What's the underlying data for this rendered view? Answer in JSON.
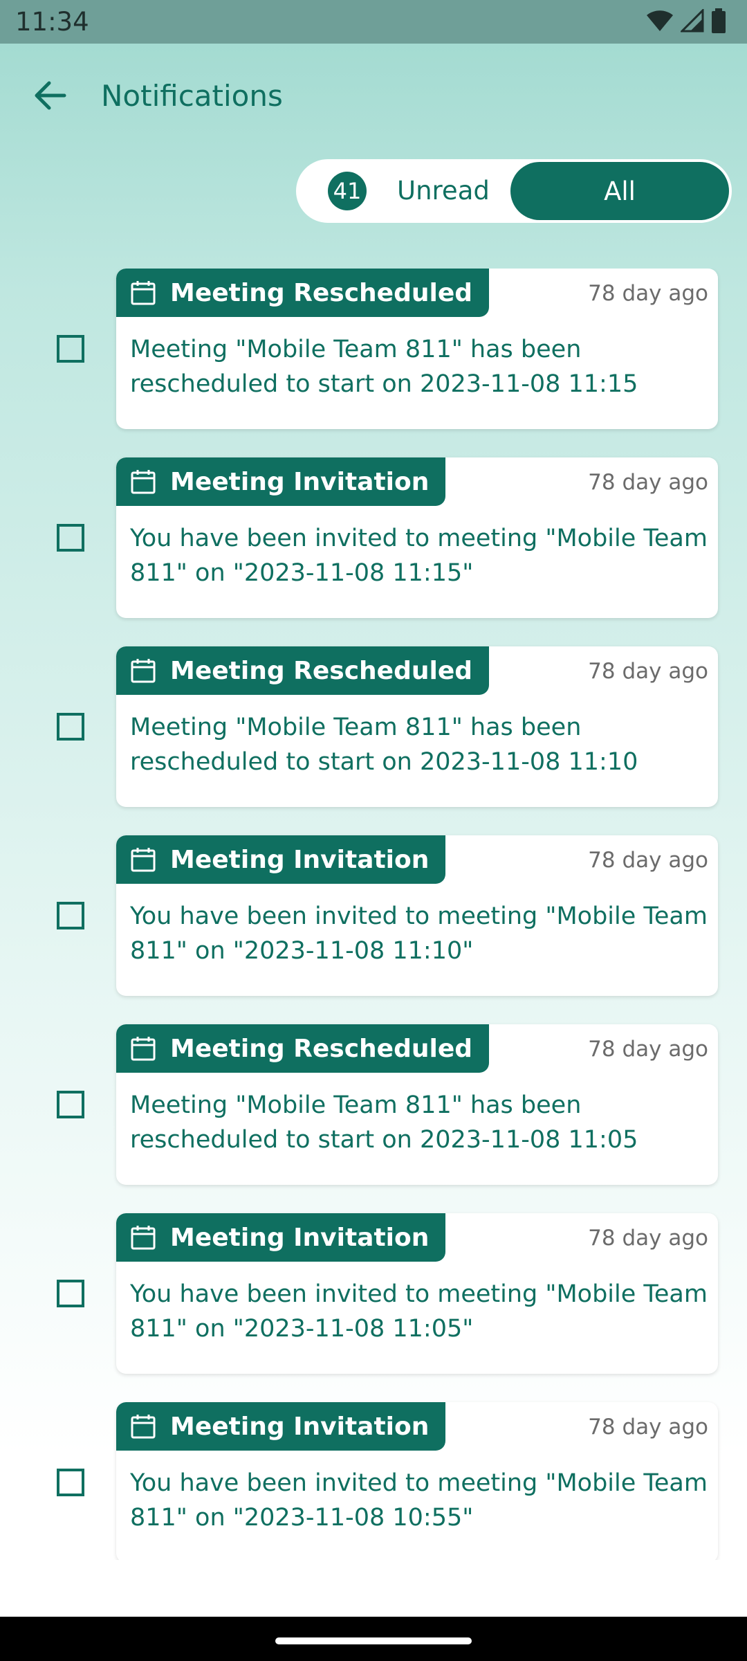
{
  "status_bar": {
    "time": "11:34",
    "icons": [
      "wifi-icon",
      "signal-icon",
      "battery-icon"
    ]
  },
  "header": {
    "title": "Notifications",
    "back_icon": "arrow-left-icon"
  },
  "filter": {
    "unread_count": "41",
    "unread_label": "Unread",
    "all_label": "All",
    "selected": "All"
  },
  "notifications": [
    {
      "type": "Meeting Rescheduled",
      "time_ago": "78 day ago",
      "message": "Meeting \"Mobile Team 811\" has been rescheduled to start on 2023-11-08 11:15",
      "checked": false
    },
    {
      "type": "Meeting Invitation",
      "time_ago": "78 day ago",
      "message": "You have been invited to meeting \"Mobile Team 811\" on \"2023-11-08 11:15\"",
      "checked": false
    },
    {
      "type": "Meeting Rescheduled",
      "time_ago": "78 day ago",
      "message": "Meeting \"Mobile Team 811\" has been rescheduled to start on 2023-11-08 11:10",
      "checked": false
    },
    {
      "type": "Meeting Invitation",
      "time_ago": "78 day ago",
      "message": "You have been invited to meeting \"Mobile Team 811\" on \"2023-11-08 11:10\"",
      "checked": false
    },
    {
      "type": "Meeting Rescheduled",
      "time_ago": "78 day ago",
      "message": "Meeting \"Mobile Team 811\" has been rescheduled to start on 2023-11-08 11:05",
      "checked": false
    },
    {
      "type": "Meeting Invitation",
      "time_ago": "78 day ago",
      "message": "You have been invited to meeting \"Mobile Team 811\" on \"2023-11-08 11:05\"",
      "checked": false
    },
    {
      "type": "Meeting Invitation",
      "time_ago": "78 day ago",
      "message": "You have been invited to meeting \"Mobile Team 811\" on \"2023-11-08 10:55\"",
      "checked": false
    }
  ],
  "colors": {
    "primary": "#0f6f60",
    "status_bar": "#6f9f98",
    "muted_text": "#6b6b6b",
    "card_background": "#ffffff"
  }
}
